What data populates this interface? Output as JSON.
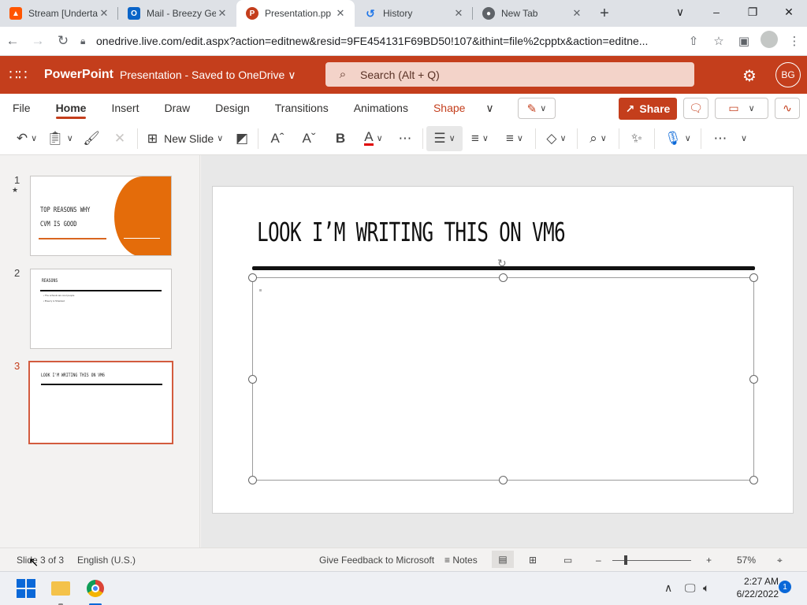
{
  "browser": {
    "tabs": [
      {
        "title": "Stream [Undertal",
        "icon": "soundcloud-icon",
        "color": "#ff5500"
      },
      {
        "title": "Mail - Breezy Ge",
        "icon": "outlook-icon",
        "color": "#0a64c8"
      },
      {
        "title": "Presentation.pp",
        "icon": "powerpoint-icon",
        "color": "#c43e1c"
      },
      {
        "title": "History",
        "icon": "history-icon",
        "color": "#1a73e8"
      },
      {
        "title": "New Tab",
        "icon": "chrome-icon",
        "color": "#5f6368"
      }
    ],
    "url": "onedrive.live.com/edit.aspx?action=editnew&resid=9FE454131F69BD50!107&ithint=file%2cpptx&action=editne..."
  },
  "app": {
    "name": "PowerPoint",
    "doc_title": "Presentation - Saved to OneDrive ∨",
    "search_placeholder": "Search (Alt + Q)",
    "avatar_initials": "BG",
    "brand_color": "#c43e1c"
  },
  "ribbon": {
    "tabs": [
      "File",
      "Home",
      "Insert",
      "Draw",
      "Design",
      "Transitions",
      "Animations",
      "Shape"
    ],
    "active_tab": "Home",
    "share_label": "Share",
    "new_slide_label": "New Slide"
  },
  "thumbnails": [
    {
      "number": "1",
      "marker": "★",
      "title_line1": "TOP REASONS WHY",
      "title_line2": "CVM IS GOOD"
    },
    {
      "number": "2",
      "title": "REASONS",
      "bullets": [
        "The schools are cool people",
        "Breezy is Shanked"
      ]
    },
    {
      "number": "3",
      "title": "LOOK I'M WRITING THIS ON VM6"
    }
  ],
  "slide": {
    "title": "LOOK I’M WRITING THIS ON VM6"
  },
  "status": {
    "slide_info": "Slide 3 of 3",
    "language": "English (U.S.)",
    "feedback": "Give Feedback to Microsoft",
    "notes": "Notes",
    "zoom": "57%"
  },
  "taskbar": {
    "time": "2:27 AM",
    "date": "6/22/2022",
    "notification_count": "1"
  }
}
